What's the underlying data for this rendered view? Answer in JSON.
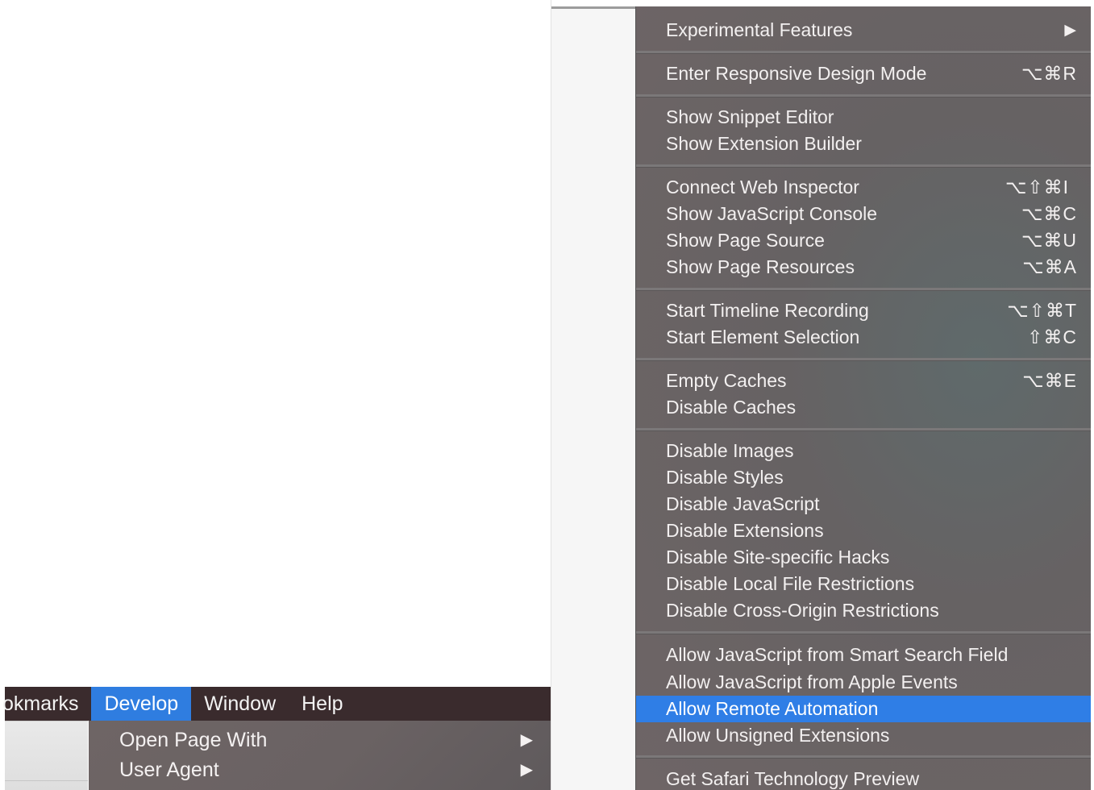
{
  "menubar": {
    "items": [
      "okmarks",
      "Develop",
      "Window",
      "Help"
    ],
    "active": "Develop"
  },
  "develop_menu_small": {
    "items": [
      {
        "label": "Open Page With",
        "submenu_arrow": "▶"
      },
      {
        "label": "User Agent",
        "submenu_arrow": "▶"
      }
    ]
  },
  "develop_menu": {
    "experimental_features": {
      "label": "Experimental Features",
      "submenu_arrow": "▶"
    },
    "responsive_design": {
      "label": "Enter Responsive Design Mode",
      "shortcut": "⌥⌘R"
    },
    "show_snippet_editor": {
      "label": "Show Snippet Editor"
    },
    "show_extension_builder": {
      "label": "Show Extension Builder"
    },
    "connect_web_inspector": {
      "label": "Connect Web Inspector",
      "shortcut": "⌥⇧⌘I"
    },
    "show_js_console": {
      "label": "Show JavaScript Console",
      "shortcut": "⌥⌘C"
    },
    "show_page_source": {
      "label": "Show Page Source",
      "shortcut": "⌥⌘U"
    },
    "show_page_resources": {
      "label": "Show Page Resources",
      "shortcut": "⌥⌘A"
    },
    "start_timeline_recording": {
      "label": "Start Timeline Recording",
      "shortcut": "⌥⇧⌘T"
    },
    "start_element_selection": {
      "label": "Start Element Selection",
      "shortcut": "⇧⌘C"
    },
    "empty_caches": {
      "label": "Empty Caches",
      "shortcut": "⌥⌘E"
    },
    "disable_caches": {
      "label": "Disable Caches"
    },
    "disable_images": {
      "label": "Disable Images"
    },
    "disable_styles": {
      "label": "Disable Styles"
    },
    "disable_javascript": {
      "label": "Disable JavaScript"
    },
    "disable_extensions": {
      "label": "Disable Extensions"
    },
    "disable_site_hacks": {
      "label": "Disable Site-specific Hacks"
    },
    "disable_local_file_restrictions": {
      "label": "Disable Local File Restrictions"
    },
    "disable_cross_origin_restrictions": {
      "label": "Disable Cross-Origin Restrictions"
    },
    "allow_js_smart_search": {
      "label": "Allow JavaScript from Smart Search Field"
    },
    "allow_js_apple_events": {
      "label": "Allow JavaScript from Apple Events"
    },
    "allow_remote_automation": {
      "label": "Allow Remote Automation",
      "highlighted": true
    },
    "allow_unsigned_extensions": {
      "label": "Allow Unsigned Extensions"
    },
    "get_safari_tp": {
      "label": "Get Safari Technology Preview"
    }
  },
  "colors": {
    "menu_background": "#6a6263",
    "menubar_background": "#3a2b2d",
    "highlight": "#2f7ee6",
    "text": "#f3f0f0"
  }
}
